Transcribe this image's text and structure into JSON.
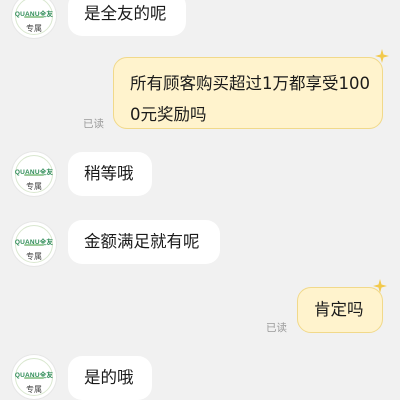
{
  "avatar": {
    "logo_text": "QUANU全友",
    "role_label": "专属"
  },
  "messages": [
    {
      "side": "in",
      "text": "是全友的呢"
    },
    {
      "side": "out",
      "text": "所有顾客购买超过1万都享受1000元奖励吗",
      "status": "已读"
    },
    {
      "side": "in",
      "text": "稍等哦"
    },
    {
      "side": "in",
      "text": "金额满足就有呢"
    },
    {
      "side": "out",
      "text": "肯定吗",
      "status": "已读"
    },
    {
      "side": "in",
      "text": "是的哦"
    }
  ],
  "colors": {
    "background": "#f1f1f1",
    "incoming_bubble": "#ffffff",
    "outgoing_bubble": "#fff3cd",
    "outgoing_border": "#f1d98a",
    "logo_green": "#2e8b57",
    "sparkle_gold": "#f2c94c"
  }
}
